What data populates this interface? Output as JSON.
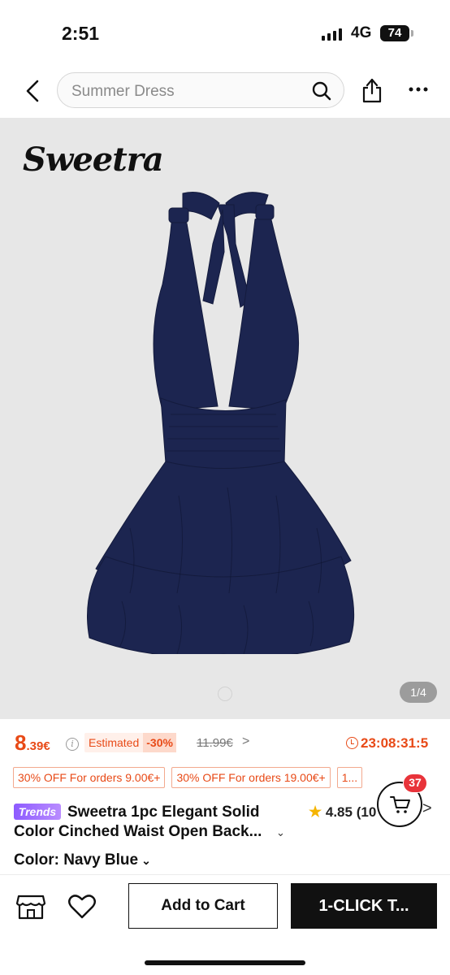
{
  "status_bar": {
    "time": "2:51",
    "network": "4G",
    "battery": "74"
  },
  "header": {
    "search_placeholder": "Summer Dress",
    "icons": [
      "back-arrow-icon",
      "search-icon",
      "share-icon",
      "more-icon"
    ]
  },
  "product_image": {
    "brand_logo": "Sweetra",
    "dress_color": "#1c2550",
    "background": "#e7e7e7",
    "counter": "1/4"
  },
  "price": {
    "main": "8",
    "cents": ".39€",
    "estimated_label": "Estimated",
    "discount": "-30%",
    "old_price": "11.99€",
    "old_price_chevron": ">",
    "timer": "23:08:31:5",
    "accent_color": "#e84a17"
  },
  "coupons": [
    "30% OFF For orders 9.00€+",
    "30% OFF For orders 19.00€+",
    "1..."
  ],
  "product": {
    "badge": "Trends",
    "title": "Sweetra 1pc Elegant Solid Color Cinched Waist Open Back...",
    "title_chevron": "⌄",
    "rating": "4.85",
    "rating_count": "(10",
    "rating_chevron": ">"
  },
  "cart": {
    "count": "37"
  },
  "color": {
    "label": "Color: Navy Blue",
    "chevron": "⌄"
  },
  "bottom_bar": {
    "add_to_cart": "Add to Cart",
    "one_click": "1-CLICK T..."
  }
}
